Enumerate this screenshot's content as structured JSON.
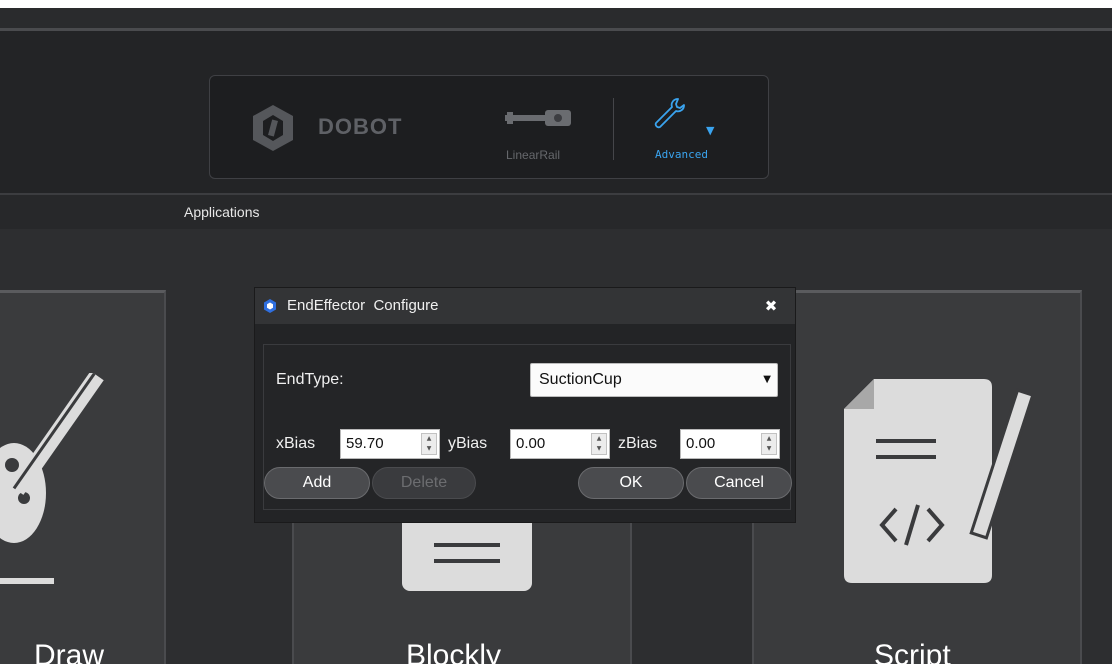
{
  "toolbar": {
    "brand": "DOBOT",
    "linear_rail_label": "LinearRail",
    "advanced_label": "Advanced"
  },
  "menubar": {
    "applications_label": "Applications"
  },
  "apps": [
    {
      "label": "Draw"
    },
    {
      "label": "Blockly"
    },
    {
      "label": "Script"
    }
  ],
  "dialog": {
    "title": "EndEffector  Configure",
    "endtype_label": "EndType:",
    "endtype_value": "SuctionCup",
    "xbias_label": "xBias",
    "xbias_value": "59.70",
    "ybias_label": "yBias",
    "ybias_value": "0.00",
    "zbias_label": "zBias",
    "zbias_value": "0.00",
    "add_label": "Add",
    "delete_label": "Delete",
    "ok_label": "OK",
    "cancel_label": "Cancel"
  },
  "colors": {
    "accent": "#3aa4ef",
    "window_bg": "#2e2f31",
    "panel_bg": "#1d1e20"
  }
}
